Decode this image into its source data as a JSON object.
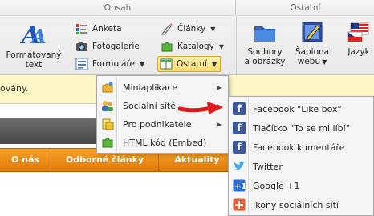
{
  "ribbon": {
    "groups": {
      "obsah": "Obsah",
      "ostatni": "Ostatní"
    },
    "formatted_text": {
      "line1": "Formátovaný",
      "line2": "text",
      "icon": "formatted-text-icon"
    },
    "anketa": "Anketa",
    "fotogalerie": "Fotogalerie",
    "formulare": "Formuláře",
    "clanky": "Články",
    "katalogy": "Katalogy",
    "ostatni": "Ostatní",
    "soubory": {
      "line1": "Soubory",
      "line2": "a obrázky"
    },
    "sablona": {
      "line1": "Šablona",
      "line2": "webu"
    },
    "jazyk": "Jazyk"
  },
  "page": {
    "notice": "ovány.",
    "nav": [
      "O nás",
      "Odborné články",
      "Aktuality"
    ]
  },
  "menu_ostatni": {
    "items": [
      {
        "label": "Miniaplikace",
        "icon": "puzzle-icon"
      },
      {
        "label": "Sociální sítě",
        "icon": "people-icon"
      },
      {
        "label": "Pro podnikatele",
        "icon": "business-icon"
      },
      {
        "label": "HTML kód (Embed)",
        "icon": "puzzle-green-icon"
      }
    ]
  },
  "menu_social": {
    "items": [
      {
        "label": "Facebook \"Like box\"",
        "icon": "facebook-icon"
      },
      {
        "label": "Tlačítko \"To se mi líbí\"",
        "icon": "facebook-icon"
      },
      {
        "label": "Facebook komentáře",
        "icon": "facebook-icon"
      },
      {
        "label": "Twitter",
        "icon": "twitter-icon"
      },
      {
        "label": "Google +1",
        "icon": "google-plus-icon"
      },
      {
        "label": "Ikony sociálních sítí",
        "icon": "social-icons-icon"
      }
    ]
  },
  "colors": {
    "accent_orange": "#f08a10",
    "menu_highlight": "#ffe790",
    "facebook": "#3b5998"
  }
}
